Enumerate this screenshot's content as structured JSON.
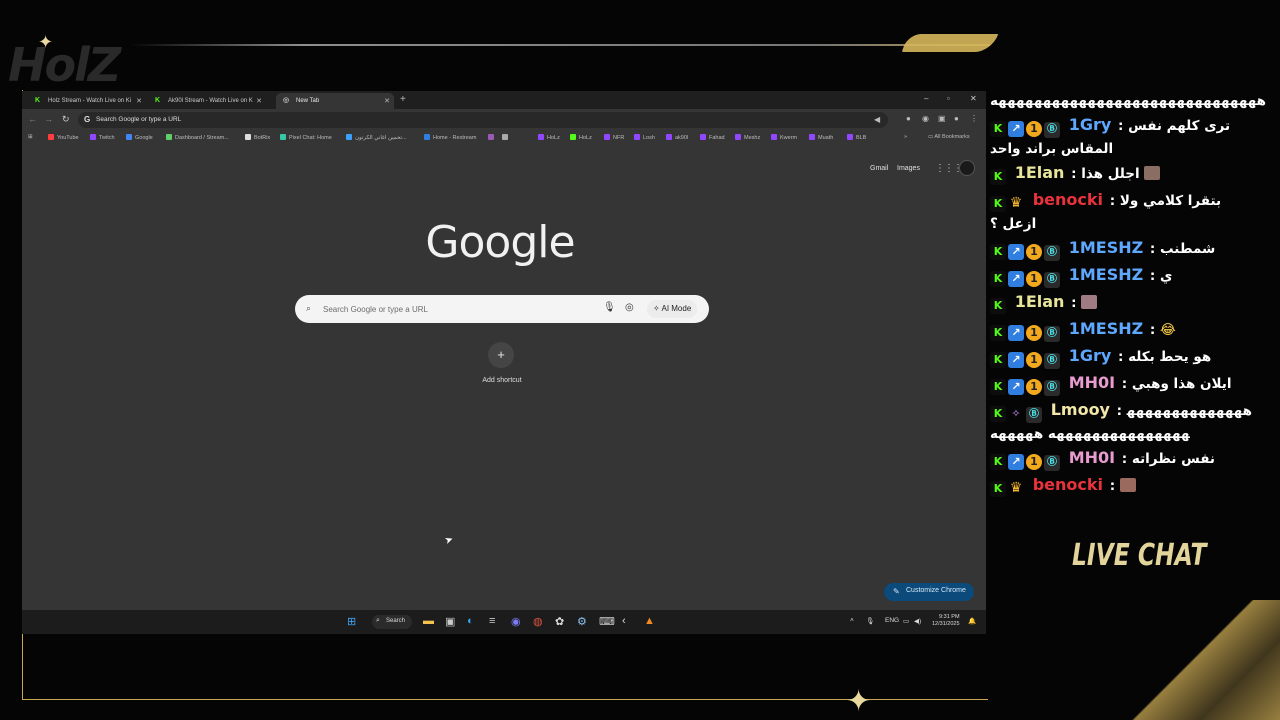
{
  "browser": {
    "tabs": [
      {
        "label": "Holz Stream - Watch Live on Ki",
        "favicon": "kick-icon"
      },
      {
        "label": "Ak90l Stream - Watch Live on K",
        "favicon": "kick-icon"
      },
      {
        "label": "New Tab",
        "favicon": "globe-icon"
      }
    ],
    "omnibox_placeholder": "Search Google or type a URL",
    "bookmarks": [
      {
        "label": "YouTube",
        "color": "#ff3d3d"
      },
      {
        "label": "Twitch",
        "color": "#9146ff"
      },
      {
        "label": "Google",
        "color": "#4285f4"
      },
      {
        "label": "Dashboard / Stream...",
        "color": "#5fcf6a"
      },
      {
        "label": "BotRix",
        "color": "#dddddd"
      },
      {
        "label": "Pixel Chat: Home",
        "color": "#35c8a6"
      },
      {
        "label": "تخمين اغاني الكرتون...",
        "color": "#3aa0ff"
      },
      {
        "label": "Home - Restream",
        "color": "#2f7ee0"
      },
      {
        "label": "HoLz",
        "color": "#9146ff"
      },
      {
        "label": "HoLz",
        "color": "#53fc18"
      },
      {
        "label": "NFR",
        "color": "#9146ff"
      },
      {
        "label": "Losh",
        "color": "#9146ff"
      },
      {
        "label": "ak90l",
        "color": "#9146ff"
      },
      {
        "label": "Fahad",
        "color": "#9146ff"
      },
      {
        "label": "Meshz",
        "color": "#9146ff"
      },
      {
        "label": "Kwerm",
        "color": "#9146ff"
      },
      {
        "label": "Muath",
        "color": "#9146ff"
      },
      {
        "label": "BLB",
        "color": "#9146ff"
      }
    ],
    "all_bookmarks": "All Bookmarks"
  },
  "ntp": {
    "gmail": "Gmail",
    "images": "Images",
    "logo": "Google",
    "search_placeholder": "Search Google or type a URL",
    "ai_mode": "AI Mode",
    "add_shortcut": "Add shortcut",
    "customize": "Customize Chrome"
  },
  "taskbar": {
    "search": "Search",
    "lang": "ENG",
    "time": "9:31 PM",
    "date": "12/31/2025"
  },
  "chat": {
    "messages": [
      {
        "user": "",
        "text": "ههههههههههههههههههههههههههههههه",
        "badges": []
      },
      {
        "user": "1Gry",
        "color": "#5fa8ff",
        "text": "ترى كلهم نفس المقاس براند واحد",
        "badges": [
          "k",
          "a",
          "1",
          "s"
        ]
      },
      {
        "user": "1Elan",
        "color": "#e8e59a",
        "text": "اجلل هذا",
        "badges": [
          "k"
        ]
      },
      {
        "user": "benocki",
        "color": "#e8323c",
        "text": "بتقرا كلامي ولا ازعل ؟",
        "badges": [
          "k",
          "c"
        ]
      },
      {
        "user": "1MESHZ",
        "color": "#5fa8ff",
        "text": "شمطنب",
        "badges": [
          "k",
          "a",
          "1",
          "s"
        ]
      },
      {
        "user": "1MESHZ",
        "color": "#5fa8ff",
        "text": "ي",
        "badges": [
          "k",
          "a",
          "1",
          "s"
        ]
      },
      {
        "user": "1Elan",
        "color": "#e8e59a",
        "text": "",
        "badges": [
          "k"
        ]
      },
      {
        "user": "1MESHZ",
        "color": "#5fa8ff",
        "text": "😂",
        "badges": [
          "k",
          "a",
          "1",
          "s"
        ]
      },
      {
        "user": "1Gry",
        "color": "#5fa8ff",
        "text": "هو يحط بكله",
        "badges": [
          "k",
          "a",
          "1",
          "s"
        ]
      },
      {
        "user": "MH0I",
        "color": "#e89bd0",
        "text": "ايلان هذا وهبي",
        "badges": [
          "k",
          "a",
          "1",
          "s"
        ]
      },
      {
        "user": "Lmooy",
        "color": "#f3e7a8",
        "text": "هههههههههههههههههههههههههههههه هههههه",
        "badges": [
          "k",
          "v",
          "s"
        ]
      },
      {
        "user": "MH0I",
        "color": "#e89bd0",
        "text": "نفس نظراته",
        "badges": [
          "k",
          "a",
          "1",
          "s"
        ]
      },
      {
        "user": "benocki",
        "color": "#e8323c",
        "text": "",
        "badges": [
          "k",
          "c"
        ]
      }
    ],
    "title": "LIVE CHAT"
  }
}
